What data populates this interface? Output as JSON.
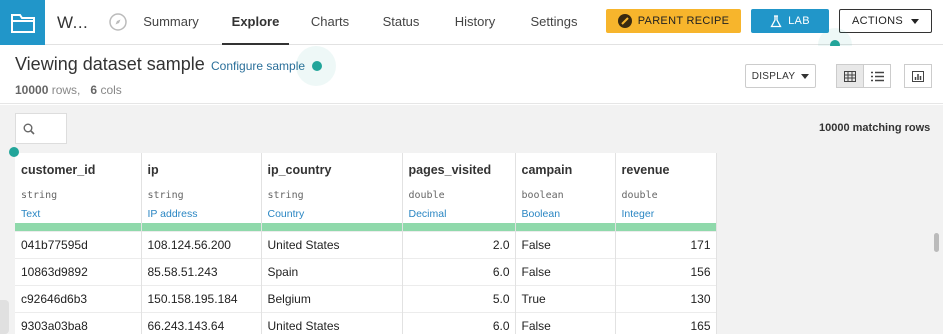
{
  "dataset": {
    "name": "W..."
  },
  "nav": {
    "tabs": [
      {
        "label": "Summary"
      },
      {
        "label": "Explore"
      },
      {
        "label": "Charts"
      },
      {
        "label": "Status"
      },
      {
        "label": "History"
      },
      {
        "label": "Settings"
      }
    ],
    "active_tab": "Explore",
    "parent_recipe_label": "PARENT RECIPE",
    "lab_label": "LAB",
    "actions_label": "ACTIONS"
  },
  "header": {
    "title": "Viewing dataset sample",
    "configure_label": "Configure sample",
    "rows_count": "10000",
    "rows_word": "rows,",
    "cols_count": "6",
    "cols_word": "cols",
    "display_label": "DISPLAY"
  },
  "filter": {
    "matching_rows": "10000 matching rows"
  },
  "table": {
    "columns": [
      {
        "name": "customer_id",
        "storage": "string",
        "meaning": "Text"
      },
      {
        "name": "ip",
        "storage": "string",
        "meaning": "IP address"
      },
      {
        "name": "ip_country",
        "storage": "string",
        "meaning": "Country"
      },
      {
        "name": "pages_visited",
        "storage": "double",
        "meaning": "Decimal"
      },
      {
        "name": "campain",
        "storage": "boolean",
        "meaning": "Boolean"
      },
      {
        "name": "revenue",
        "storage": "double",
        "meaning": "Integer"
      }
    ],
    "rows": [
      [
        "041b77595d",
        "108.124.56.200",
        "United States",
        "2.0",
        "False",
        "171"
      ],
      [
        "10863d9892",
        "85.58.51.243",
        "Spain",
        "6.0",
        "False",
        "156"
      ],
      [
        "c92646d6b3",
        "150.158.195.184",
        "Belgium",
        "5.0",
        "True",
        "130"
      ],
      [
        "9303a03ba8",
        "66.243.143.64",
        "United States",
        "6.0",
        "False",
        "165"
      ]
    ]
  },
  "colors": {
    "accent_blue": "#2196c9",
    "parent_recipe_yellow": "#f7b52c",
    "valid_bar_green": "#8fd9ab",
    "meaning_blue": "#2a86c3",
    "teal_dot": "#22a59a"
  },
  "icons": {
    "app": "folder-icon",
    "compass": "compass-icon",
    "parent_recipe": "brush-icon",
    "lab": "flask-icon",
    "search": "search-icon",
    "table_view": "table-grid-icon",
    "list_view": "list-icon",
    "chart_view": "bar-chart-icon"
  }
}
